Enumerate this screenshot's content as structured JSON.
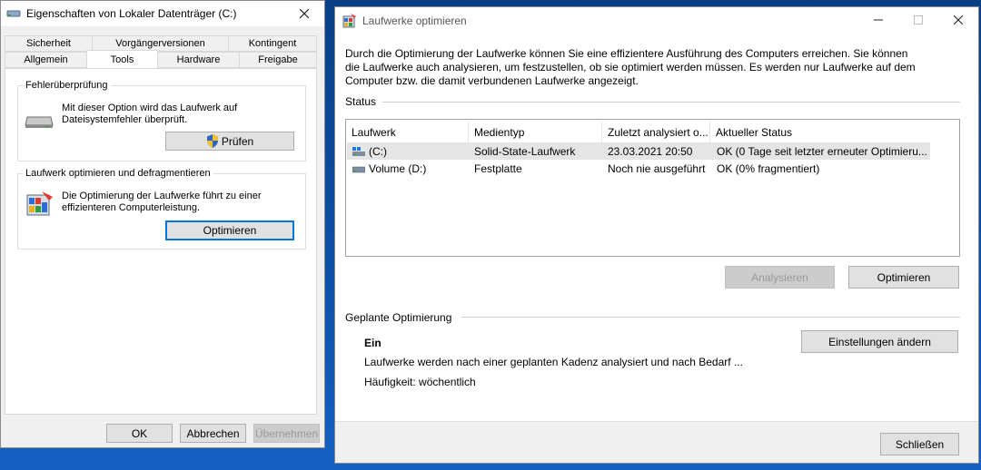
{
  "props_window": {
    "title": "Eigenschaften von Lokaler Datenträger (C:)",
    "tabs_row1": [
      "Sicherheit",
      "Vorgängerversionen",
      "Kontingent"
    ],
    "tabs_row2": [
      "Allgemein",
      "Tools",
      "Hardware",
      "Freigabe"
    ],
    "active_tab": "Tools",
    "error_check": {
      "group_title": "Fehlerüberprüfung",
      "description_line1": "Mit dieser Option wird das Laufwerk auf",
      "description_line2": "Dateisystemfehler überprüft.",
      "button_label": "Prüfen"
    },
    "optimize": {
      "group_title": "Laufwerk optimieren und defragmentieren",
      "description_line1": "Die Optimierung der Laufwerke führt zu einer",
      "description_line2": "effizienteren Computerleistung.",
      "button_label": "Optimieren"
    },
    "buttons": {
      "ok": "OK",
      "cancel": "Abbrechen",
      "apply": "Übernehmen"
    }
  },
  "optimize_window": {
    "title": "Laufwerke optimieren",
    "intro_line1": "Durch die Optimierung der Laufwerke können Sie eine effizientere Ausführung des Computers erreichen. Sie können",
    "intro_line2": "die Laufwerke auch analysieren, um festzustellen, ob sie optimiert werden müssen. Es werden nur Laufwerke auf dem",
    "intro_line3": "Computer bzw. die damit verbundenen Laufwerke angezeigt.",
    "status_label": "Status",
    "columns": [
      "Laufwerk",
      "Medientyp",
      "Zuletzt analysiert o...",
      "Aktueller Status"
    ],
    "drives": [
      {
        "name": "(C:)",
        "media": "Solid-State-Laufwerk",
        "last": "23.03.2021 20:50",
        "status": "OK (0 Tage seit letzter erneuter Optimieru..."
      },
      {
        "name": "Volume (D:)",
        "media": "Festplatte",
        "last": "Noch nie ausgeführt",
        "status": "OK (0% fragmentiert)"
      }
    ],
    "analyze_button": "Analysieren",
    "optimize_button": "Optimieren",
    "scheduled": {
      "section_label": "Geplante Optimierung",
      "state": "Ein",
      "description": "Laufwerke werden nach einer geplanten Kadenz analysiert und nach Bedarf ...",
      "frequency": "Häufigkeit: wöchentlich",
      "change_button": "Einstellungen ändern"
    },
    "close_button": "Schließen"
  },
  "colors": {
    "accent": "#0078d7",
    "selected_row": "#e5e5e5",
    "desktop": "#0b4fa6"
  },
  "icons": [
    "drive-icon",
    "close-icon",
    "minimize-icon",
    "maximize-icon",
    "shield-icon",
    "defrag-icon",
    "ssd-icon",
    "hdd-icon"
  ]
}
